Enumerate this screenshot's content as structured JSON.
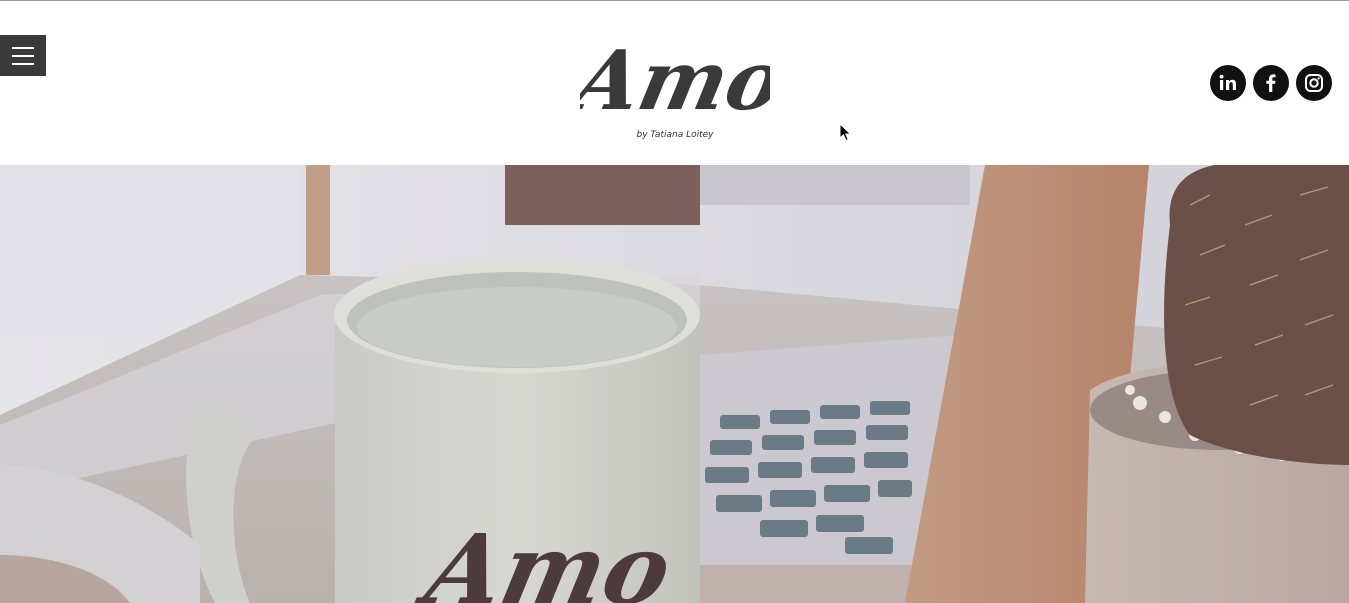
{
  "brand": {
    "logo_text": "Amo",
    "tagline": "by Tatiana Loitey"
  },
  "header": {
    "menu_icon": "hamburger-menu-icon"
  },
  "social": [
    {
      "name": "linkedin",
      "icon": "linkedin-icon",
      "label": "in"
    },
    {
      "name": "facebook",
      "icon": "facebook-icon",
      "label": "f"
    },
    {
      "name": "instagram",
      "icon": "instagram-icon",
      "label": ""
    }
  ],
  "hero": {
    "mug_logo_text": "Amo"
  },
  "colors": {
    "header_bg": "#ffffff",
    "menu_bg": "#3a3a3a",
    "social_bg": "#111111",
    "logo_ink": "#3a3a3a"
  }
}
